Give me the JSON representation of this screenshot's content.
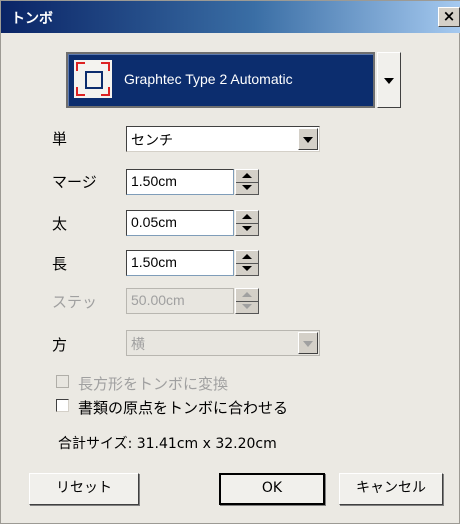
{
  "window": {
    "title": "トンボ",
    "close_label": "×"
  },
  "preset": {
    "label": "Graphtec Type 2 Automatic",
    "icon": "crop-mark-icon"
  },
  "unit": {
    "label": "単",
    "value": "センチ"
  },
  "margin": {
    "label": "マージ",
    "value": "1.50cm"
  },
  "thickness": {
    "label": "太",
    "value": "0.05cm"
  },
  "length": {
    "label": "長",
    "value": "1.50cm"
  },
  "step": {
    "label": "ステッ",
    "value": "50.00cm"
  },
  "direction": {
    "label": "方",
    "value": "横"
  },
  "options": {
    "convert_rect_label": "長方形をトンボに変換",
    "align_origin_label": "書類の原点をトンボに合わせる"
  },
  "total_size": "合計サイズ:  31.41cm x 32.20cm",
  "buttons": {
    "reset": "リセット",
    "ok": "OK",
    "cancel": "キャンセル"
  },
  "colors": {
    "selection": "#0c2d6e",
    "titlebar": "#0a2466",
    "background": "#ebe9e3"
  }
}
